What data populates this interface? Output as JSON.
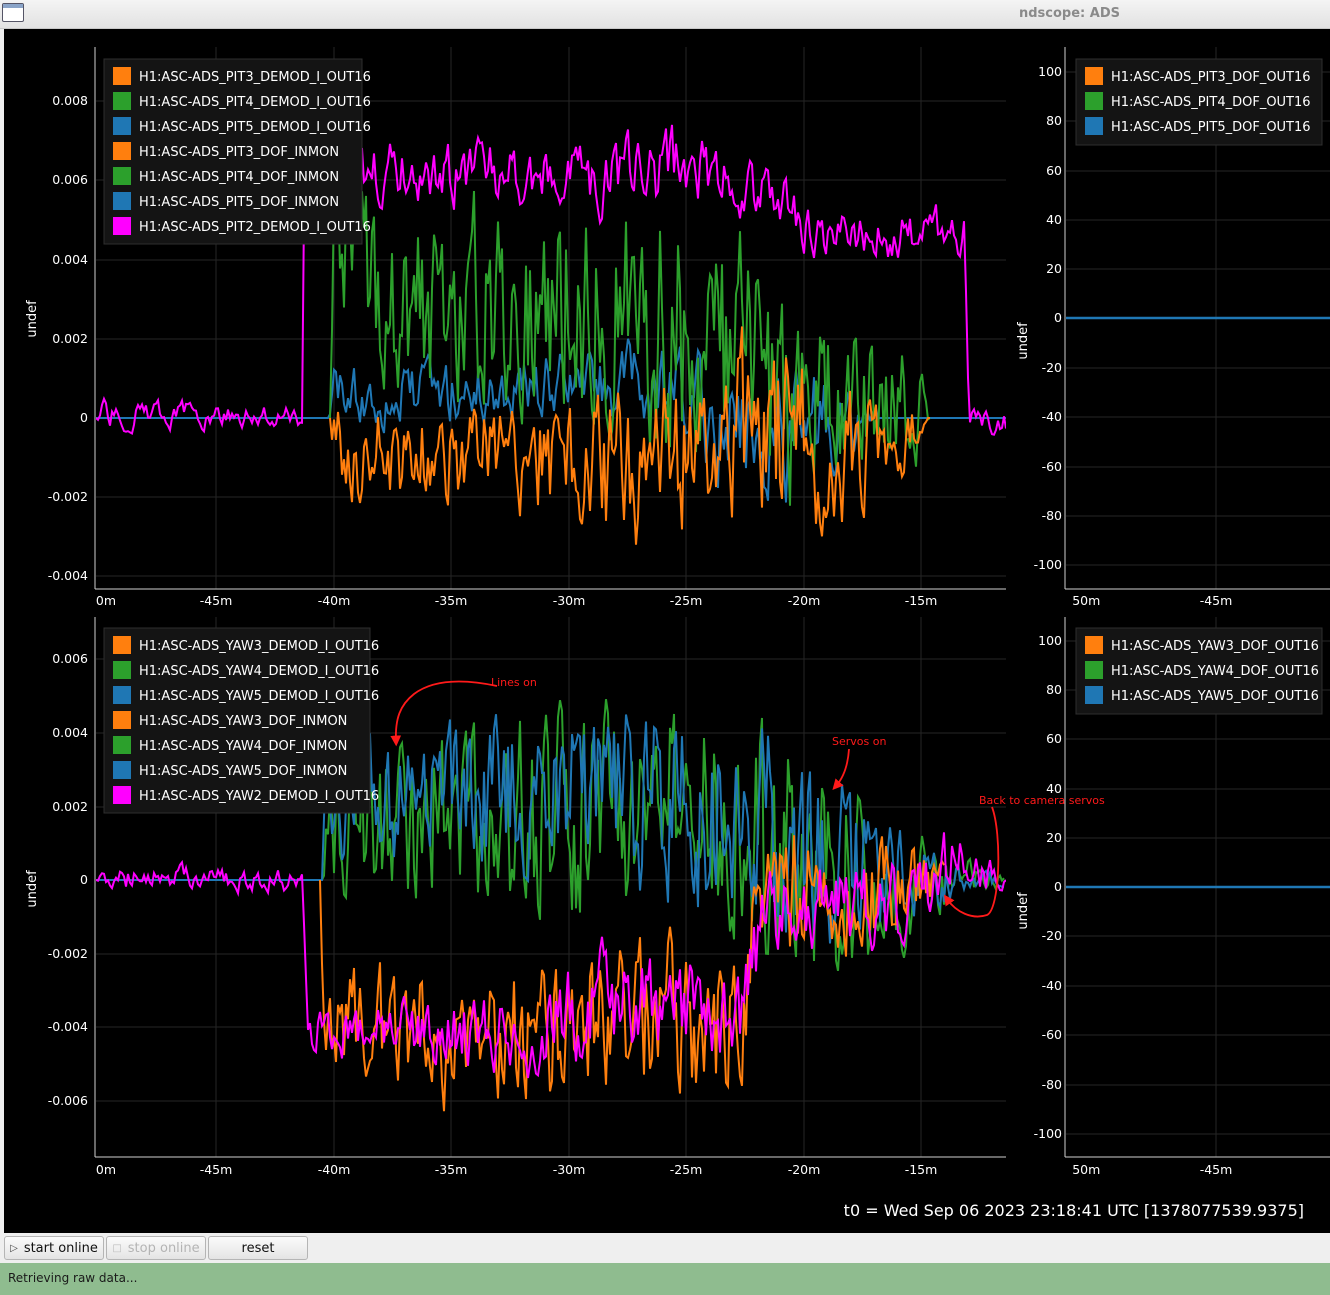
{
  "window": {
    "title": "ndscope: ADS"
  },
  "colors": {
    "orange": "#ff7f0e",
    "green": "#2ca02c",
    "blue": "#1f77b4",
    "magenta": "#ff00ff",
    "annotation": "#ff1a1a",
    "status_bg": "#8fbc8f"
  },
  "plots": {
    "top_left": {
      "ylabel": "undef",
      "yticks": [
        "0.008",
        "0.006",
        "0.004",
        "0.002",
        "0",
        "-0.002",
        "-0.004"
      ],
      "xticks": [
        "0m",
        "-45m",
        "-40m",
        "-35m",
        "-30m",
        "-25m",
        "-20m",
        "-15m"
      ],
      "legend": [
        {
          "label": "H1:ASC-ADS_PIT3_DEMOD_I_OUT16",
          "color": "#ff7f0e"
        },
        {
          "label": "H1:ASC-ADS_PIT4_DEMOD_I_OUT16",
          "color": "#2ca02c"
        },
        {
          "label": "H1:ASC-ADS_PIT5_DEMOD_I_OUT16",
          "color": "#1f77b4"
        },
        {
          "label": "H1:ASC-ADS_PIT3_DOF_INMON",
          "color": "#ff7f0e"
        },
        {
          "label": "H1:ASC-ADS_PIT4_DOF_INMON",
          "color": "#2ca02c"
        },
        {
          "label": "H1:ASC-ADS_PIT5_DOF_INMON",
          "color": "#1f77b4"
        },
        {
          "label": "H1:ASC-ADS_PIT2_DEMOD_I_OUT16",
          "color": "#ff00ff"
        }
      ]
    },
    "top_right": {
      "ylabel": "undef",
      "yticks": [
        "100",
        "80",
        "60",
        "40",
        "20",
        "0",
        "-20",
        "-40",
        "-60",
        "-80",
        "-100"
      ],
      "xticks": [
        "-50m",
        "-45m"
      ],
      "legend": [
        {
          "label": "H1:ASC-ADS_PIT3_DOF_OUT16",
          "color": "#ff7f0e"
        },
        {
          "label": "H1:ASC-ADS_PIT4_DOF_OUT16",
          "color": "#2ca02c"
        },
        {
          "label": "H1:ASC-ADS_PIT5_DOF_OUT16",
          "color": "#1f77b4"
        }
      ]
    },
    "bottom_left": {
      "ylabel": "undef",
      "yticks": [
        "0.006",
        "0.004",
        "0.002",
        "0",
        "-0.002",
        "-0.004",
        "-0.006"
      ],
      "xticks": [
        "0m",
        "-45m",
        "-40m",
        "-35m",
        "-30m",
        "-25m",
        "-20m",
        "-15m"
      ],
      "legend": [
        {
          "label": "H1:ASC-ADS_YAW3_DEMOD_I_OUT16",
          "color": "#ff7f0e"
        },
        {
          "label": "H1:ASC-ADS_YAW4_DEMOD_I_OUT16",
          "color": "#2ca02c"
        },
        {
          "label": "H1:ASC-ADS_YAW5_DEMOD_I_OUT16",
          "color": "#1f77b4"
        },
        {
          "label": "H1:ASC-ADS_YAW3_DOF_INMON",
          "color": "#ff7f0e"
        },
        {
          "label": "H1:ASC-ADS_YAW4_DOF_INMON",
          "color": "#2ca02c"
        },
        {
          "label": "H1:ASC-ADS_YAW5_DOF_INMON",
          "color": "#1f77b4"
        },
        {
          "label": "H1:ASC-ADS_YAW2_DEMOD_I_OUT16",
          "color": "#ff00ff"
        }
      ],
      "annotations": [
        "Lines on",
        "Servos on",
        "Back to camera servos"
      ]
    },
    "bottom_right": {
      "ylabel": "undef",
      "yticks": [
        "100",
        "80",
        "60",
        "40",
        "20",
        "0",
        "-20",
        "-40",
        "-60",
        "-80",
        "-100"
      ],
      "xticks": [
        "-50m",
        "-45m"
      ],
      "legend": [
        {
          "label": "H1:ASC-ADS_YAW3_DOF_OUT16",
          "color": "#ff7f0e"
        },
        {
          "label": "H1:ASC-ADS_YAW4_DOF_OUT16",
          "color": "#2ca02c"
        },
        {
          "label": "H1:ASC-ADS_YAW5_DOF_OUT16",
          "color": "#1f77b4"
        }
      ]
    }
  },
  "t0_text": "t0 = Wed Sep 06 2023 23:18:41 UTC [1378077539.9375]",
  "toolbar": {
    "start_online": "start online",
    "stop_online": "stop online",
    "reset": "reset"
  },
  "status": {
    "text": "Retrieving raw data..."
  }
}
